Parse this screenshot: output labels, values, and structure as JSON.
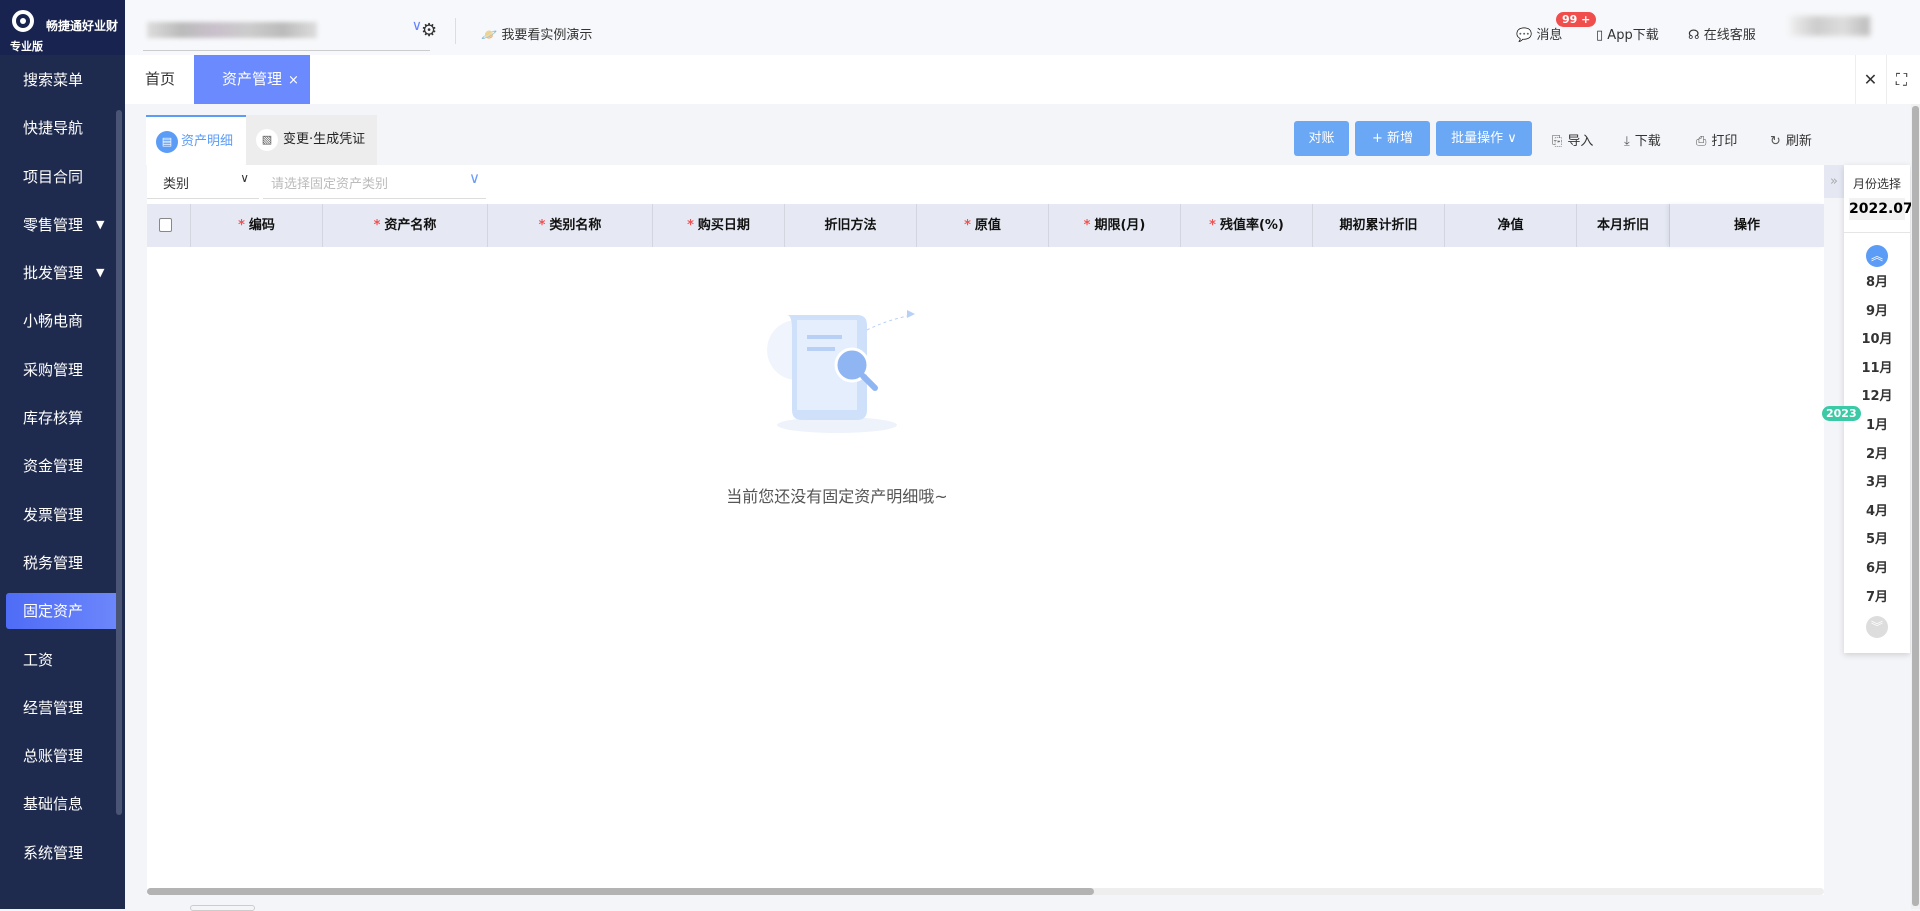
{
  "brand": {
    "name": "畅捷通好业财",
    "edition": "专业版"
  },
  "topbar": {
    "demo": "我要看实例演示",
    "messages": "消息",
    "badge": "99 +",
    "app": "App下载",
    "service": "在线客服"
  },
  "sidebar": {
    "items": [
      {
        "label": "搜索菜单"
      },
      {
        "label": "快捷导航"
      },
      {
        "label": "项目合同"
      },
      {
        "label": "零售管理",
        "arrow": "▼"
      },
      {
        "label": "批发管理",
        "arrow": "▼"
      },
      {
        "label": "小畅电商"
      },
      {
        "label": "采购管理"
      },
      {
        "label": "库存核算"
      },
      {
        "label": "资金管理"
      },
      {
        "label": "发票管理"
      },
      {
        "label": "税务管理"
      },
      {
        "label": "固定资产",
        "active": true
      },
      {
        "label": "工资"
      },
      {
        "label": "经营管理"
      },
      {
        "label": "总账管理"
      },
      {
        "label": "基础信息"
      },
      {
        "label": "系统管理"
      }
    ]
  },
  "tabs": {
    "home": "首页",
    "active": "资产管理",
    "close": "×"
  },
  "subtabs": {
    "detail": "资产明细",
    "change": "变更·生成凭证"
  },
  "toolbar": {
    "reconcile": "对账",
    "add": "+ 新增",
    "batch": "批量操作 ∨",
    "import": "导入",
    "download": "下载",
    "print": "打印",
    "refresh": "刷新"
  },
  "filter": {
    "type": "类别",
    "category_placeholder": "请选择固定资产类别"
  },
  "table": {
    "columns": [
      {
        "label": "编码",
        "required": true
      },
      {
        "label": "资产名称",
        "required": true
      },
      {
        "label": "类别名称",
        "required": true
      },
      {
        "label": "购买日期",
        "required": true
      },
      {
        "label": "折旧方法"
      },
      {
        "label": "原值",
        "required": true
      },
      {
        "label": "期限(月)",
        "required": true
      },
      {
        "label": "残值率(%)",
        "required": true
      },
      {
        "label": "期初累计折旧"
      },
      {
        "label": "净值"
      },
      {
        "label": "本月折旧"
      },
      {
        "label": "操作"
      }
    ],
    "empty": "当前您还没有固定资产明细哦~"
  },
  "month_panel": {
    "title": "月份选择",
    "current": "2022.07",
    "year_tag": "2023",
    "months": [
      "8月",
      "9月",
      "10月",
      "11月",
      "12月",
      "1月",
      "2月",
      "3月",
      "4月",
      "5月",
      "6月",
      "7月"
    ]
  },
  "colors": {
    "sidebar": "#1f2b4e",
    "accent": "#6b8afd",
    "button": "#6aa8f5",
    "required": "#f05050",
    "year_tag": "#3cc9a6"
  }
}
